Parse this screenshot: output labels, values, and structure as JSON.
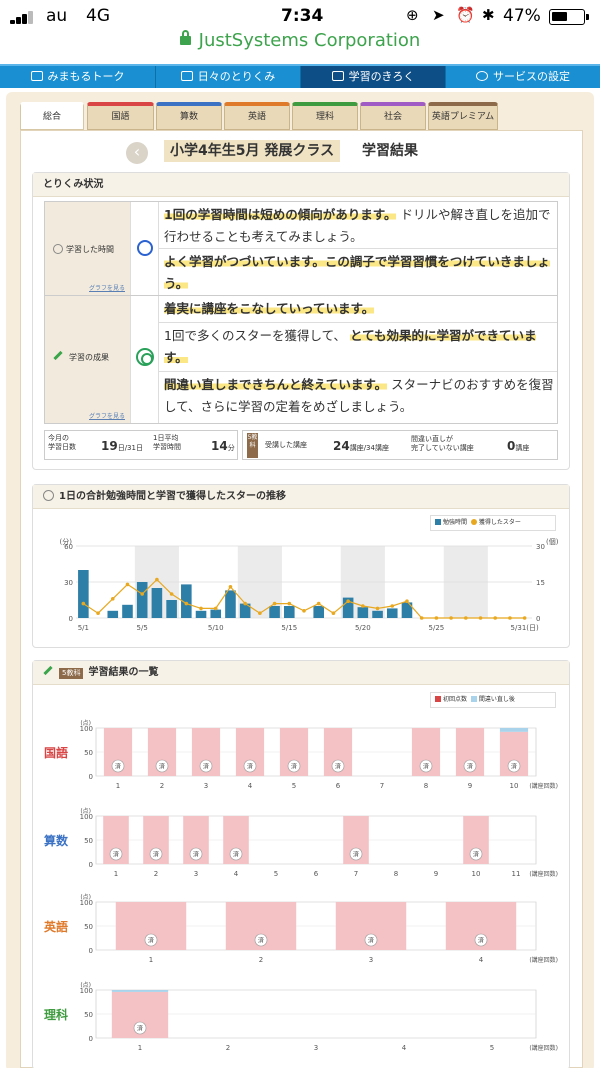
{
  "status_bar": {
    "carrier": "au",
    "network": "4G",
    "time": "7:34",
    "battery": "47%"
  },
  "url_bar": {
    "domain": "JustSystems Corporation"
  },
  "top_nav": [
    {
      "label": "みまもるトーク"
    },
    {
      "label": "日々のとりくみ"
    },
    {
      "label": "学習のきろく"
    },
    {
      "label": "サービスの設定"
    }
  ],
  "subject_tabs": [
    {
      "label": "総合",
      "color": "#ffffff"
    },
    {
      "label": "国語",
      "color": "#d94545"
    },
    {
      "label": "算数",
      "color": "#3b72c4"
    },
    {
      "label": "英語",
      "color": "#e07a2b"
    },
    {
      "label": "理科",
      "color": "#3f9b3f"
    },
    {
      "label": "社会",
      "color": "#a05bc4"
    },
    {
      "label": "英語プレミアム",
      "color": "#8c6a4a"
    }
  ],
  "page": {
    "title": "小学4年生5月 発展クラス",
    "title_suffix": "学習結果",
    "back": "‹"
  },
  "progress": {
    "heading": "とりくみ状況",
    "time_label": "学習した時間",
    "result_label": "学習の成果",
    "graph_link": "グラフを見る",
    "comments": {
      "c1_hl": "1回の学習時間は短めの傾向があります。",
      "c1_rest": "ドリルや解き直しを追加で行わせることも考えてみましょう。",
      "c2_hl": "よく学習がつづいています。この調子で学習習慣をつけていきましょう。",
      "c3_hl": "着実に講座をこなしていっています。",
      "c4_pre": "1回で多くのスターを獲得して、",
      "c4_hl": "とても効果的に学習ができています。",
      "c5_hl": "間違い直しまできちんと終えています。",
      "c5_rest": "スターナビのおすすめを復習して、さらに学習の定着をめざしましょう。"
    },
    "stats": {
      "days_label1": "今月の",
      "days_label2": "学習日数",
      "days_value": "19",
      "days_unit": "日/31日",
      "avg_label1": "1日平均",
      "avg_label2": "学習時間",
      "avg_value": "14",
      "avg_unit": "分",
      "badge": "5教科",
      "course_label": "受講した講座",
      "course_value": "24",
      "course_unit": "講座/34講座",
      "unfinished_label1": "間違い直しが",
      "unfinished_label2": "完了していない講座",
      "unfinished_value": "0",
      "unfinished_unit": "講座"
    }
  },
  "colors": {
    "bar": "#2e7fa8",
    "star": "#e8a820",
    "first": "#f4c1c4",
    "redo": "#a9d3ea",
    "weekend": "#ebebeb"
  },
  "chart_data": [
    {
      "type": "bar+line",
      "title": "1日の合計勉強時間と学習で獲得したスターの推移",
      "legend": [
        "勉強時間",
        "獲得したスター"
      ],
      "y_left_label": "(分)",
      "y_left_ticks": [
        0,
        30,
        60
      ],
      "y_left_range": [
        0,
        60
      ],
      "y_right_label": "(個)",
      "y_right_ticks": [
        0,
        15,
        30
      ],
      "y_right_range": [
        0,
        30
      ],
      "x_ticks": [
        "5/1",
        "5/5",
        "5/10",
        "5/15",
        "5/20",
        "5/25",
        "5/31(日)"
      ],
      "days": [
        1,
        2,
        3,
        4,
        5,
        6,
        7,
        8,
        9,
        10,
        11,
        12,
        13,
        14,
        15,
        16,
        17,
        18,
        19,
        20,
        21,
        22,
        23,
        24,
        25,
        26,
        27,
        28,
        29,
        30,
        31
      ],
      "study_minutes": [
        40,
        0,
        6,
        11,
        30,
        25,
        15,
        28,
        6,
        7,
        23,
        12,
        0,
        10,
        10,
        0,
        10,
        0,
        17,
        9,
        6,
        8,
        13,
        0,
        0,
        0,
        0,
        0,
        0,
        0,
        0
      ],
      "stars": [
        6,
        2,
        8,
        14,
        10,
        16,
        10,
        6,
        4,
        4,
        13,
        6,
        2,
        6,
        6,
        3,
        6,
        2,
        7,
        5,
        4,
        5,
        7,
        0,
        0,
        0,
        0,
        0,
        0,
        0,
        0
      ],
      "weekend_bands": [
        [
          5,
          7
        ],
        [
          12,
          14
        ],
        [
          19,
          21
        ],
        [
          26,
          28
        ]
      ]
    },
    {
      "type": "bar",
      "title": "学習結果の一覧",
      "badge": "5教科",
      "legend": [
        "初回点数",
        "間違い直し後"
      ],
      "y_unit": "(点)",
      "y_ticks": [
        0,
        50,
        100
      ],
      "x_suffix": "(講座回数)",
      "subjects": [
        {
          "name": "国語",
          "color": "#d94545",
          "lessons": 10,
          "first": [
            100,
            100,
            100,
            100,
            100,
            100,
            0,
            100,
            100,
            92
          ],
          "redo": [
            0,
            0,
            0,
            0,
            0,
            0,
            0,
            0,
            0,
            8
          ]
        },
        {
          "name": "算数",
          "color": "#3b72c4",
          "lessons": 11,
          "first": [
            100,
            100,
            100,
            100,
            0,
            0,
            100,
            0,
            0,
            100,
            0
          ],
          "redo": [
            0,
            0,
            0,
            0,
            0,
            0,
            0,
            0,
            0,
            0,
            0
          ]
        },
        {
          "name": "英語",
          "color": "#e07a2b",
          "lessons": 4,
          "first": [
            100,
            100,
            100,
            100
          ],
          "redo": [
            0,
            0,
            0,
            0
          ]
        },
        {
          "name": "理科",
          "color": "#3f9b3f",
          "lessons": 5,
          "first": [
            96,
            0,
            0,
            0,
            0
          ],
          "redo": [
            4,
            0,
            0,
            0,
            0
          ]
        }
      ],
      "done_mark": "済"
    }
  ]
}
